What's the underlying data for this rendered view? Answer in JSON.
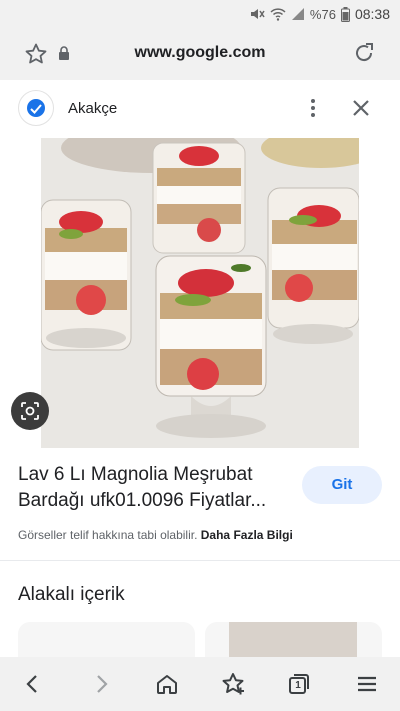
{
  "status_bar": {
    "battery": "%76",
    "time": "08:38",
    "icons": [
      "mute-icon",
      "wifi-icon",
      "signal-icon",
      "battery-icon"
    ]
  },
  "browser": {
    "url": "www.google.com",
    "icons": [
      "star-icon",
      "lock-icon",
      "reload-icon"
    ]
  },
  "source": {
    "name": "Akakçe",
    "icons": [
      "source-logo-icon",
      "more-vert-icon",
      "close-icon"
    ]
  },
  "result": {
    "title": "Lav 6 Lı Magnolia Meşrubat Bardağı ufk01.0096 Fiyatlar...",
    "visit_label": "Git",
    "copyright_text": "Görseller telif hakkına tabi olabilir.",
    "more_info_label": "Daha Fazla Bilgi"
  },
  "related": {
    "title": "Alakalı içerik"
  },
  "bottom_nav": {
    "tab_count": "1",
    "icons": [
      "back-icon",
      "forward-icon",
      "home-icon",
      "bookmark-star-icon",
      "tabs-icon",
      "menu-icon"
    ]
  },
  "colors": {
    "accent": "#1a73e8",
    "button_bg": "#e8f0fe",
    "chrome_bg": "#f1f1f1"
  }
}
